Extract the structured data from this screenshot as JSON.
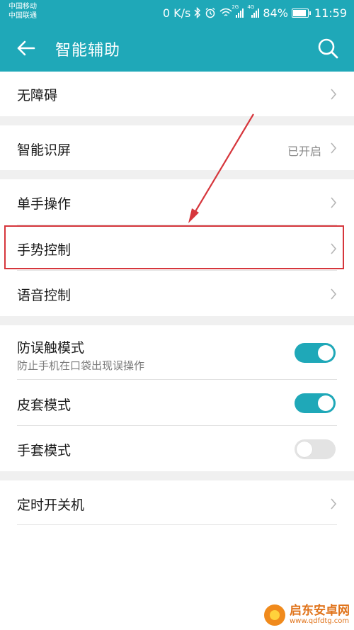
{
  "status_bar": {
    "carrier_1": "中国移动",
    "carrier_2": "中国联通",
    "net_speed": "0 K/s",
    "signal_1_tag": "2G",
    "signal_2_tag": "4G",
    "battery_text": "84%",
    "battery_level": 0.84,
    "time": "11:59",
    "icons": [
      "bluetooth-icon",
      "alarm-icon",
      "wifi-icon",
      "signal-icon",
      "battery-icon"
    ]
  },
  "app_bar": {
    "title": "智能辅助",
    "back_icon": "arrow-left-icon",
    "search_icon": "search-icon",
    "color": "#1fa8b8"
  },
  "settings": {
    "accessibility": {
      "label": "无障碍"
    },
    "smart_screen_recognition": {
      "label": "智能识屏",
      "value": "已开启"
    },
    "one_hand_mode": {
      "label": "单手操作"
    },
    "gesture_control": {
      "label": "手势控制"
    },
    "voice_control": {
      "label": "语音控制"
    },
    "pocket_mode": {
      "label": "防误触模式",
      "description": "防止手机在口袋出现误操作",
      "enabled": true
    },
    "cover_mode": {
      "label": "皮套模式",
      "enabled": true
    },
    "glove_mode": {
      "label": "手套模式",
      "enabled": false
    },
    "scheduled_power": {
      "label": "定时开关机"
    }
  },
  "annotation": {
    "color": "#d6363c",
    "highlighted_item": "手势控制"
  },
  "watermark": {
    "name": "启东安卓网",
    "url": "www.qdfdtg.com"
  }
}
